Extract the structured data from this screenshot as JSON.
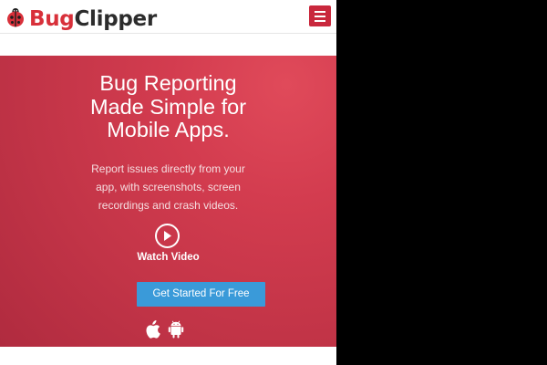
{
  "brand": {
    "name_part1": "Bug",
    "name_part2": "Clipper",
    "accent_color": "#d8303a"
  },
  "hero": {
    "title": "Bug Reporting Made Simple for Mobile Apps.",
    "subtitle": "Report issues directly from your app, with screenshots, screen recordings and crash videos.",
    "watch_label": "Watch Video",
    "cta_label": "Get Started For Free",
    "platforms": [
      "apple-icon",
      "android-icon"
    ]
  },
  "colors": {
    "hero_bg": "#c23447",
    "cta_bg": "#3a9ad9",
    "menu_bg": "#c9283d"
  }
}
